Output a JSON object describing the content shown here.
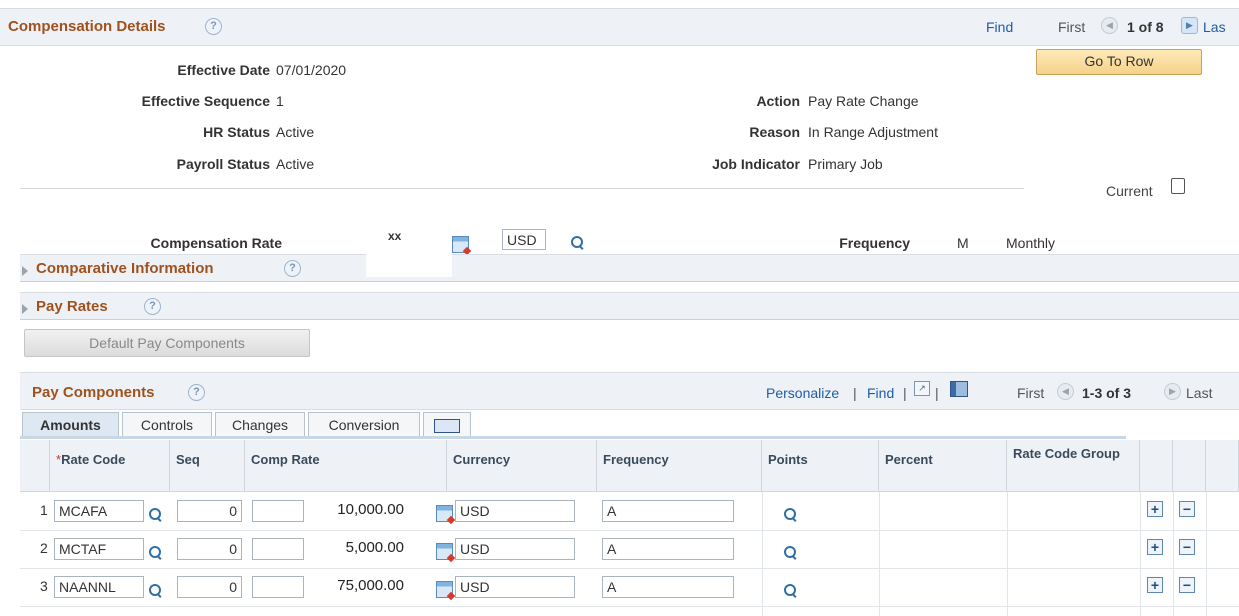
{
  "header": {
    "title": "Compensation Details",
    "find": "Find",
    "first": "First",
    "count": "1 of 8",
    "last": "Las"
  },
  "go_to_row": "Go To Row",
  "fields": {
    "effective_date_label": "Effective Date",
    "effective_date": "07/01/2020",
    "effective_sequence_label": "Effective Sequence",
    "effective_sequence": "1",
    "hr_status_label": "HR Status",
    "hr_status": "Active",
    "payroll_status_label": "Payroll Status",
    "payroll_status": "Active",
    "action_label": "Action",
    "action": "Pay Rate Change",
    "reason_label": "Reason",
    "reason": "In Range Adjustment",
    "job_indicator_label": "Job Indicator",
    "job_indicator": "Primary Job",
    "current_label": "Current"
  },
  "comp_rate": {
    "label": "Compensation Rate",
    "value": "xx",
    "currency": "USD",
    "frequency_label": "Frequency",
    "frequency_code": "M",
    "frequency_desc": "Monthly"
  },
  "sections": {
    "comparative": "Comparative Information",
    "pay_rates": "Pay Rates"
  },
  "default_button": "Default Pay Components",
  "pay_components": {
    "title": "Pay Components",
    "personalize": "Personalize",
    "find": "Find",
    "first": "First",
    "count": "1-3 of 3",
    "last": "Last",
    "tabs": [
      "Amounts",
      "Controls",
      "Changes",
      "Conversion"
    ],
    "columns": {
      "required_mark": "*",
      "rate_code": "Rate Code",
      "seq": "Seq",
      "comp_rate": "Comp Rate",
      "currency": "Currency",
      "frequency": "Frequency",
      "points": "Points",
      "percent": "Percent",
      "rate_code_group": "Rate Code Group"
    },
    "rows": [
      {
        "num": "1",
        "rate_code": "MCAFA",
        "seq": "0",
        "comp_rate": "10,000.00",
        "currency": "USD",
        "frequency": "A"
      },
      {
        "num": "2",
        "rate_code": "MCTAF",
        "seq": "0",
        "comp_rate": "5,000.00",
        "currency": "USD",
        "frequency": "A"
      },
      {
        "num": "3",
        "rate_code": "NAANNL",
        "seq": "0",
        "comp_rate": "75,000.00",
        "currency": "USD",
        "frequency": "A"
      }
    ]
  }
}
